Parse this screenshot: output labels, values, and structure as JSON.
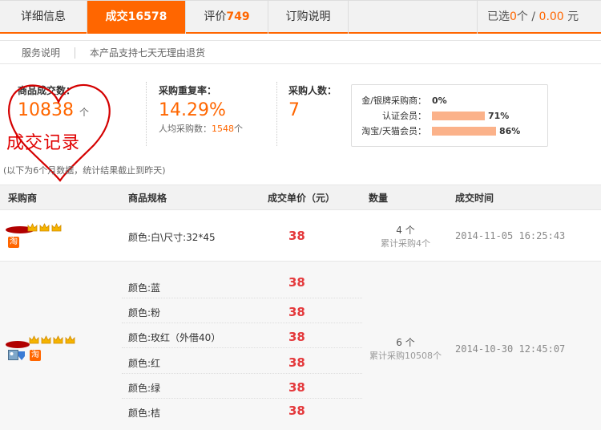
{
  "tabs": [
    {
      "label": "详细信息",
      "num": ""
    },
    {
      "label": "成交",
      "num": "16578"
    },
    {
      "label": "评价",
      "num": "749"
    },
    {
      "label": "订购说明",
      "num": ""
    }
  ],
  "selected": {
    "prefix": "已选",
    "count": "0",
    "unit": "个 /",
    "amount": "0.00",
    "currency": "元"
  },
  "service": {
    "label": "服务说明",
    "text": "本产品支持七天无理由退货"
  },
  "stats": {
    "deals": {
      "label": "商品成交数：",
      "value": "10838",
      "unit": "个"
    },
    "repurchase": {
      "label": "采购重复率：",
      "value": "14.29%",
      "sub_prefix": "人均采购数：",
      "sub_value": "1548",
      "sub_unit": "个"
    },
    "buyers": {
      "label": "采购人数：",
      "value": "7"
    }
  },
  "members": [
    {
      "label": "金/银牌采购商：",
      "pct": "0%",
      "fraction": 0
    },
    {
      "label": "认证会员：",
      "pct": "71%",
      "fraction": 0.71
    },
    {
      "label": "淘宝/天猫会员：",
      "pct": "86%",
      "fraction": 0.86
    }
  ],
  "annotation": "成交记录",
  "note": "(以下为6个月数据，统计结果截止到昨天)",
  "table": {
    "headers": [
      "采购商",
      "商品规格",
      "成交单价（元）",
      "数量",
      "成交时间"
    ],
    "rows": [
      {
        "specs": [
          {
            "spec": "颜色:白\\尺寸:32*45",
            "price": "38"
          }
        ],
        "qty": "4 个",
        "total": "累计采购4个",
        "time": "2014-11-05 16:25:43",
        "crowns": 3,
        "badges": [
          "淘"
        ]
      },
      {
        "specs": [
          {
            "spec": "颜色:蓝",
            "price": "38"
          },
          {
            "spec": "颜色:粉",
            "price": "38"
          },
          {
            "spec": "颜色:玫红（外借40）",
            "price": "38"
          },
          {
            "spec": "颜色:红",
            "price": "38"
          },
          {
            "spec": "颜色:绿",
            "price": "38"
          },
          {
            "spec": "颜色:桔",
            "price": "38"
          }
        ],
        "qty": "6 个",
        "total": "累计采购10508个",
        "time": "2014-10-30 12:45:07",
        "crowns": 4,
        "badges": [
          "淘"
        ]
      }
    ]
  },
  "colors": {
    "accent": "#ff6600",
    "price": "#e4393c",
    "bar": "#fbb28a",
    "annotation": "#e00000"
  }
}
